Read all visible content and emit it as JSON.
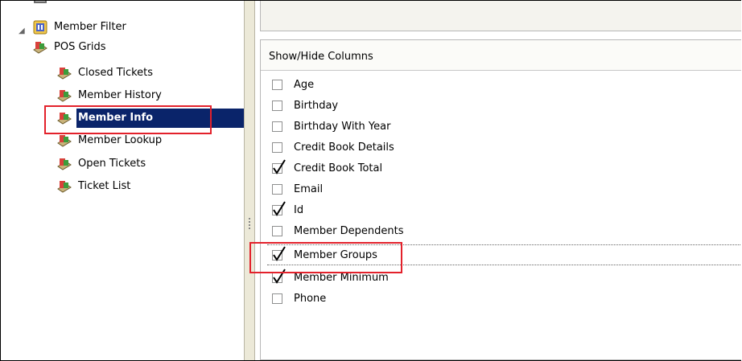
{
  "tree": {
    "items": [
      {
        "label": "Member Filter",
        "icon": "filter-report-icon"
      },
      {
        "label": "POS Grids",
        "icon": "grid-folder-icon",
        "expanded": true
      },
      {
        "label": "Closed Tickets",
        "icon": "grid-report-icon"
      },
      {
        "label": "Member History",
        "icon": "grid-report-icon"
      },
      {
        "label": "Member Info",
        "icon": "grid-report-icon",
        "selected": true
      },
      {
        "label": "Member Lookup",
        "icon": "grid-report-icon"
      },
      {
        "label": "Open Tickets",
        "icon": "grid-report-icon"
      },
      {
        "label": "Ticket List",
        "icon": "grid-report-icon"
      }
    ]
  },
  "columns_panel": {
    "title": "Show/Hide Columns",
    "items": [
      {
        "label": "Age",
        "checked": false
      },
      {
        "label": "Birthday",
        "checked": false
      },
      {
        "label": "Birthday With Year",
        "checked": false
      },
      {
        "label": "Credit Book Details",
        "checked": false
      },
      {
        "label": "Credit Book Total",
        "checked": true
      },
      {
        "label": "Email",
        "checked": false
      },
      {
        "label": "Id",
        "checked": true
      },
      {
        "label": "Member Dependents",
        "checked": false
      },
      {
        "label": "Member Groups",
        "checked": true,
        "focused": true
      },
      {
        "label": "Member Minimum",
        "checked": true
      },
      {
        "label": "Phone",
        "checked": false
      }
    ]
  },
  "colors": {
    "selection": "#0a246a",
    "highlight_box": "#e3212b"
  }
}
